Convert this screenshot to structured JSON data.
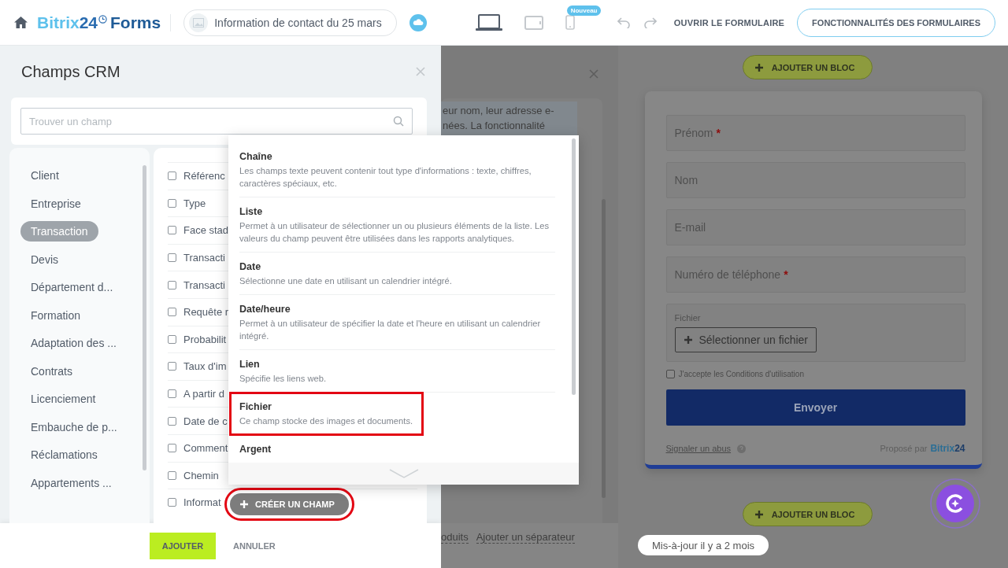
{
  "header": {
    "logo": {
      "brand": "Bitrix",
      "number": "24",
      "product": "Forms"
    },
    "form_title": "Information de contact du 25 mars",
    "devices": [
      {
        "kind": "laptop",
        "selected": true
      },
      {
        "kind": "tablet",
        "selected": false
      },
      {
        "kind": "phone",
        "selected": false,
        "badge": "Nouveau"
      }
    ],
    "open_link": "OUVRIR LE FORMULAIRE",
    "features_button": "FONCTIONNALITÉS DES FORMULAIRES"
  },
  "crm_panel": {
    "title": "Champs CRM",
    "search": {
      "placeholder": "Trouver un champ"
    },
    "categories": [
      {
        "label": "Client",
        "selected": false
      },
      {
        "label": "Entreprise",
        "selected": false
      },
      {
        "label": "Transaction",
        "selected": true
      },
      {
        "label": "Devis",
        "selected": false
      },
      {
        "label": "Département d...",
        "selected": false
      },
      {
        "label": "Formation",
        "selected": false
      },
      {
        "label": "Adaptation des ...",
        "selected": false
      },
      {
        "label": "Contrats",
        "selected": false
      },
      {
        "label": "Licenciement",
        "selected": false
      },
      {
        "label": "Embauche de p...",
        "selected": false
      },
      {
        "label": "Réclamations",
        "selected": false
      },
      {
        "label": "Appartements ...",
        "selected": false
      }
    ],
    "fields": [
      {
        "label": "Référenc",
        "checked": false
      },
      {
        "label": "Type",
        "checked": false
      },
      {
        "label": "Face stad",
        "checked": false
      },
      {
        "label": "Transacti",
        "checked": false
      },
      {
        "label": "Transacti",
        "checked": false
      },
      {
        "label": "Requête r",
        "checked": false
      },
      {
        "label": "Probabilit",
        "checked": false
      },
      {
        "label": "Taux d'im",
        "checked": false
      },
      {
        "label": "A partir d",
        "checked": false
      },
      {
        "label": "Date de c",
        "checked": false
      },
      {
        "label": "Comment",
        "checked": false
      },
      {
        "label": "Chemin",
        "checked": false
      },
      {
        "label": "Informat",
        "checked": false
      }
    ],
    "create_button": {
      "label": "CRÉER UN CHAMP",
      "highlighted": true
    },
    "add_button": "AJOUTER",
    "cancel_button": "ANNULER"
  },
  "field_types_menu": {
    "items": [
      {
        "title": "Chaîne",
        "description": "Les champs texte peuvent contenir tout type d'informations : texte, chiffres, caractères spéciaux, etc.",
        "highlighted": false
      },
      {
        "title": "Liste",
        "description": "Permet à un utilisateur de sélectionner un ou plusieurs éléments de la liste. Les valeurs du champ peuvent être utilisées dans les rapports analytiques.",
        "highlighted": false
      },
      {
        "title": "Date",
        "description": "Sélectionne une date en utilisant un calendrier intégré.",
        "highlighted": false
      },
      {
        "title": "Date/heure",
        "description": "Permet à un utilisateur de spécifier la date et l'heure en utilisant un calendrier intégré.",
        "highlighted": false
      },
      {
        "title": "Lien",
        "description": "Spécifie les liens web.",
        "highlighted": false
      },
      {
        "title": "Fichier",
        "description": "Ce champ stocke des images et documents.",
        "highlighted": true
      },
      {
        "title": "Argent",
        "highlighted": false
      }
    ]
  },
  "settings_panel": {
    "text_lines": [
      "eur nom, leur adresse e-",
      "nées. La fonctionnalité"
    ],
    "footer_links": [
      "oduits",
      "Ajouter un séparateur"
    ]
  },
  "form_preview": {
    "add_block_top": "AJOUTER UN BLOC",
    "fields": [
      {
        "kind": "text",
        "label": "Prénom",
        "required": true
      },
      {
        "kind": "text",
        "label": "Nom",
        "required": false
      },
      {
        "kind": "text",
        "label": "E-mail",
        "required": false
      },
      {
        "kind": "text",
        "label": "Numéro de téléphone",
        "required": true
      },
      {
        "kind": "file",
        "label": "Fichier",
        "button": "Sélectionner un fichier",
        "required": false
      }
    ],
    "required_marker": "*",
    "consent": {
      "label": "J'accepte les Conditions d'utilisation",
      "checked": false
    },
    "submit": "Envoyer",
    "report_link": "Signaler un abus",
    "powered_by": "Proposé par",
    "brand": {
      "name": "Bitrix",
      "number": "24"
    },
    "add_block_bottom": "AJOUTER UN BLOC"
  },
  "update_status": "Mis-à-jour il y a 2 mois"
}
